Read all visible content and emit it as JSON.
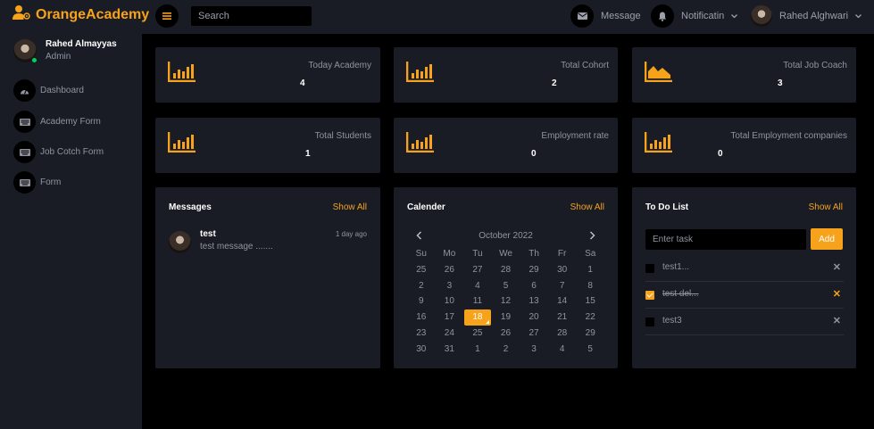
{
  "brand": {
    "name": "OrangeAcademy"
  },
  "search": {
    "placeholder": "Search"
  },
  "topbar": {
    "message_label": "Message",
    "notification_label": "Notificatin",
    "user_name": "Rahed Alghwari"
  },
  "sidebar": {
    "profile": {
      "name": "Rahed Almayyas",
      "role": "Admin"
    },
    "items": [
      {
        "label": "Dashboard",
        "icon": "speedometer-icon"
      },
      {
        "label": "Academy Form",
        "icon": "keyboard-icon"
      },
      {
        "label": "Job Cotch Form",
        "icon": "keyboard-icon"
      },
      {
        "label": "Form",
        "icon": "keyboard-icon"
      }
    ]
  },
  "stats": [
    {
      "label": "Today Academy",
      "value": "4",
      "icon": "bar-chart-icon"
    },
    {
      "label": "Total Cohort",
      "value": "2",
      "icon": "bar-chart-icon"
    },
    {
      "label": "Total Job Coach",
      "value": "3",
      "icon": "area-chart-icon"
    },
    {
      "label": "Total Students",
      "value": "1",
      "icon": "bar-chart-icon"
    },
    {
      "label": "Employment rate",
      "value": "0",
      "icon": "bar-chart-icon"
    },
    {
      "label": "Total Employment companies",
      "value": "0",
      "icon": "bar-chart-icon"
    }
  ],
  "messages": {
    "title": "Messages",
    "show_all": "Show All",
    "items": [
      {
        "name": "test",
        "text": "test message .......",
        "time": "1 day ago"
      }
    ]
  },
  "calendar": {
    "title": "Calender",
    "show_all": "Show All",
    "month": "October 2022",
    "weekdays": [
      "Su",
      "Mo",
      "Tu",
      "We",
      "Th",
      "Fr",
      "Sa"
    ],
    "days": [
      "25",
      "26",
      "27",
      "28",
      "29",
      "30",
      "1",
      "2",
      "3",
      "4",
      "5",
      "6",
      "7",
      "8",
      "9",
      "10",
      "11",
      "12",
      "13",
      "14",
      "15",
      "16",
      "17",
      "18",
      "19",
      "20",
      "21",
      "22",
      "23",
      "24",
      "25",
      "26",
      "27",
      "28",
      "29",
      "30",
      "31",
      "1",
      "2",
      "3",
      "4",
      "5"
    ],
    "selected_day": "18"
  },
  "todo": {
    "title": "To Do List",
    "show_all": "Show All",
    "input_placeholder": "Enter task",
    "add_label": "Add",
    "items": [
      {
        "text": "test1...",
        "done": false
      },
      {
        "text": "test del...",
        "done": true
      },
      {
        "text": "test3",
        "done": false
      }
    ]
  },
  "colors": {
    "accent": "#f7a21b",
    "card": "#191c24",
    "background": "#000000",
    "online": "#00d25b"
  }
}
